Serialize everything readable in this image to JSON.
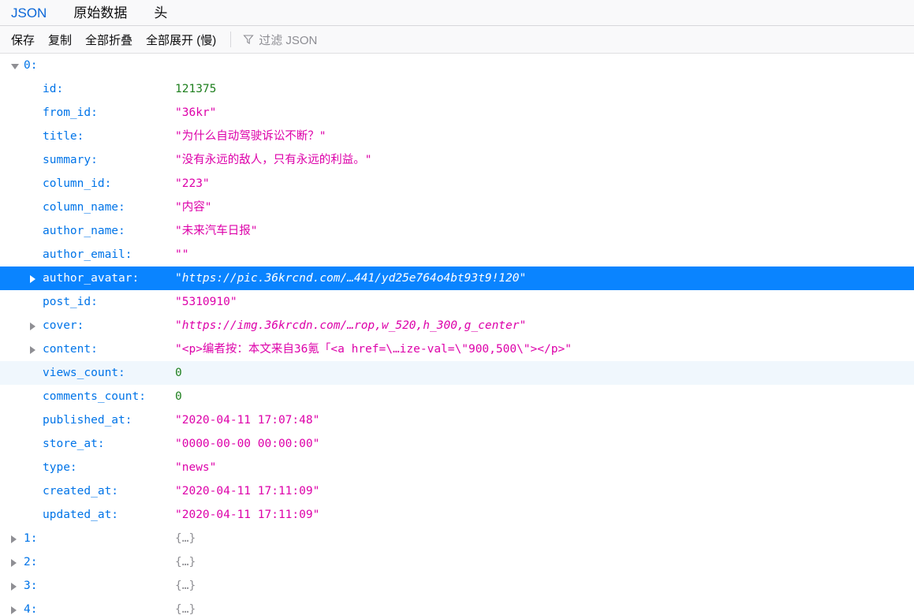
{
  "tabs": [
    {
      "label": "JSON",
      "active": true
    },
    {
      "label": "原始数据",
      "active": false
    },
    {
      "label": "头",
      "active": false
    }
  ],
  "toolbar": {
    "save_label": "保存",
    "copy_label": "复制",
    "collapse_all_label": "全部折叠",
    "expand_all_label": "全部展开 (慢)",
    "filter_icon": "funnel-icon",
    "filter_placeholder": "过滤 JSON"
  },
  "colors": {
    "key": "#0074e8",
    "string": "#dd00a9",
    "number": "#1e7f1e",
    "object": "#8f8f94",
    "selection": "#0a84ff",
    "stripe": "#f0f7fd",
    "tab_active": "#0a67d8",
    "chrome": "#f9f9fa"
  },
  "rows": [
    {
      "level": 1,
      "twisty": "open",
      "key": "0:",
      "value": "",
      "type": "none",
      "stripe": false,
      "selected": false
    },
    {
      "level": 2,
      "twisty": "none",
      "key": "id:",
      "value": "121375",
      "type": "number",
      "stripe": false,
      "selected": false
    },
    {
      "level": 2,
      "twisty": "none",
      "key": "from_id:",
      "value": "\"36kr\"",
      "type": "string",
      "stripe": false,
      "selected": false
    },
    {
      "level": 2,
      "twisty": "none",
      "key": "title:",
      "value": "\"为什么自动驾驶诉讼不断？\"",
      "type": "string",
      "stripe": false,
      "selected": false
    },
    {
      "level": 2,
      "twisty": "none",
      "key": "summary:",
      "value": "\"没有永远的敌人，只有永远的利益。\"",
      "type": "string",
      "stripe": false,
      "selected": false
    },
    {
      "level": 2,
      "twisty": "none",
      "key": "column_id:",
      "value": "\"223\"",
      "type": "string",
      "stripe": false,
      "selected": false
    },
    {
      "level": 2,
      "twisty": "none",
      "key": "column_name:",
      "value": "\"内容\"",
      "type": "string",
      "stripe": false,
      "selected": false
    },
    {
      "level": 2,
      "twisty": "none",
      "key": "author_name:",
      "value": "\"未来汽车日报\"",
      "type": "string",
      "stripe": false,
      "selected": false
    },
    {
      "level": 2,
      "twisty": "none",
      "key": "author_email:",
      "value": "\"\"",
      "type": "string",
      "stripe": false,
      "selected": false
    },
    {
      "level": 2,
      "twisty": "closed",
      "key": "author_avatar:",
      "value": "\"https://pic.36krcnd.com/…441/yd25e764o4bt93t9!120\"",
      "type": "link",
      "stripe": false,
      "selected": true
    },
    {
      "level": 2,
      "twisty": "none",
      "key": "post_id:",
      "value": "\"5310910\"",
      "type": "string",
      "stripe": false,
      "selected": false
    },
    {
      "level": 2,
      "twisty": "closed",
      "key": "cover:",
      "value": "\"https://img.36krcdn.com/…rop,w_520,h_300,g_center\"",
      "type": "link",
      "stripe": false,
      "selected": false
    },
    {
      "level": 2,
      "twisty": "closed",
      "key": "content:",
      "value": "\"<p>编者按：本文来自36氪「<a href=\\…ize-val=\\\"900,500\\\"></p>\"",
      "type": "string",
      "stripe": false,
      "selected": false
    },
    {
      "level": 2,
      "twisty": "none",
      "key": "views_count:",
      "value": "0",
      "type": "number",
      "stripe": true,
      "selected": false
    },
    {
      "level": 2,
      "twisty": "none",
      "key": "comments_count:",
      "value": "0",
      "type": "number",
      "stripe": false,
      "selected": false
    },
    {
      "level": 2,
      "twisty": "none",
      "key": "published_at:",
      "value": "\"2020-04-11 17:07:48\"",
      "type": "string",
      "stripe": false,
      "selected": false
    },
    {
      "level": 2,
      "twisty": "none",
      "key": "store_at:",
      "value": "\"0000-00-00 00:00:00\"",
      "type": "string",
      "stripe": false,
      "selected": false
    },
    {
      "level": 2,
      "twisty": "none",
      "key": "type:",
      "value": "\"news\"",
      "type": "string",
      "stripe": false,
      "selected": false
    },
    {
      "level": 2,
      "twisty": "none",
      "key": "created_at:",
      "value": "\"2020-04-11 17:11:09\"",
      "type": "string",
      "stripe": false,
      "selected": false
    },
    {
      "level": 2,
      "twisty": "none",
      "key": "updated_at:",
      "value": "\"2020-04-11 17:11:09\"",
      "type": "string",
      "stripe": false,
      "selected": false
    },
    {
      "level": 1,
      "twisty": "closed",
      "key": "1:",
      "value": "{…}",
      "type": "object",
      "stripe": false,
      "selected": false
    },
    {
      "level": 1,
      "twisty": "closed",
      "key": "2:",
      "value": "{…}",
      "type": "object",
      "stripe": false,
      "selected": false
    },
    {
      "level": 1,
      "twisty": "closed",
      "key": "3:",
      "value": "{…}",
      "type": "object",
      "stripe": false,
      "selected": false
    },
    {
      "level": 1,
      "twisty": "closed",
      "key": "4:",
      "value": "{…}",
      "type": "object",
      "stripe": false,
      "selected": false
    }
  ]
}
